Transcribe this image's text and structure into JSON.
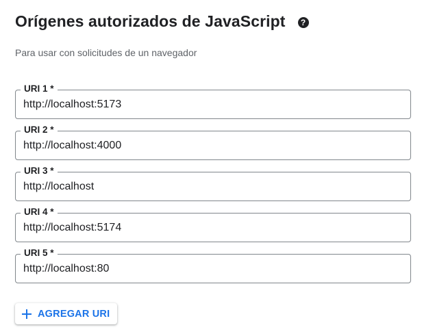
{
  "section": {
    "title": "Orígenes autorizados de JavaScript",
    "help_icon": "help-circle-icon",
    "subtitle": "Para usar con solicitudes de un navegador"
  },
  "uris": [
    {
      "label": "URI 1 *",
      "value": "http://localhost:5173"
    },
    {
      "label": "URI 2 *",
      "value": "http://localhost:4000"
    },
    {
      "label": "URI 3 *",
      "value": "http://localhost"
    },
    {
      "label": "URI 4 *",
      "value": "http://localhost:5174"
    },
    {
      "label": "URI 5 *",
      "value": "http://localhost:80"
    }
  ],
  "add_button": {
    "label": "AGREGAR URI",
    "icon": "plus-icon"
  },
  "colors": {
    "accent": "#1a73e8",
    "border": "#80868b",
    "text": "#202124",
    "secondary_text": "#5f6368"
  }
}
